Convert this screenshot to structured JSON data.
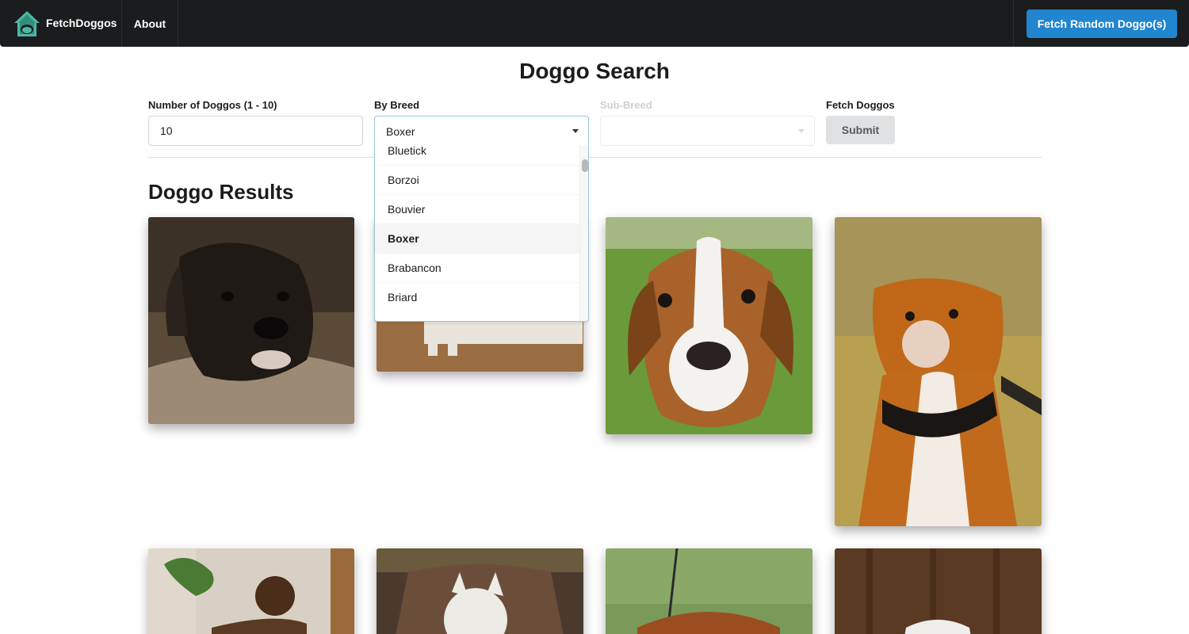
{
  "navbar": {
    "brand": "FetchDoggos",
    "about": "About",
    "fetch_random": "Fetch Random Doggo(s)",
    "colors": {
      "background": "#1b1c1d",
      "accent": "#2185d0",
      "logo": "#4fb8a4"
    }
  },
  "search": {
    "title": "Doggo Search",
    "count_label": "Number of Doggos (1 - 10)",
    "count_value": "10",
    "breed_label": "By Breed",
    "breed_value": "Boxer",
    "breed_options": [
      {
        "label": "Bluetick",
        "selected": false
      },
      {
        "label": "Borzoi",
        "selected": false
      },
      {
        "label": "Bouvier",
        "selected": false
      },
      {
        "label": "Boxer",
        "selected": true
      },
      {
        "label": "Brabancon",
        "selected": false
      },
      {
        "label": "Briard",
        "selected": false
      }
    ],
    "sub_breed_label": "Sub-Breed",
    "sub_breed_value": "",
    "fetch_label": "Fetch Doggos",
    "submit_label": "Submit"
  },
  "results": {
    "title": "Doggo Results",
    "images": [
      {
        "description": "dark brindle boxer puppy lying on couch"
      },
      {
        "description": "white boxer on dirt ground, partially hidden"
      },
      {
        "description": "fawn and white boxer puppy on grass"
      },
      {
        "description": "fawn boxer wearing spiked collar"
      },
      {
        "description": "brindle boxer standing in living room"
      },
      {
        "description": "white boxer lying on dark couch"
      },
      {
        "description": "fawn boxer on green background"
      },
      {
        "description": "white boxer in front of wooden wall"
      }
    ]
  }
}
